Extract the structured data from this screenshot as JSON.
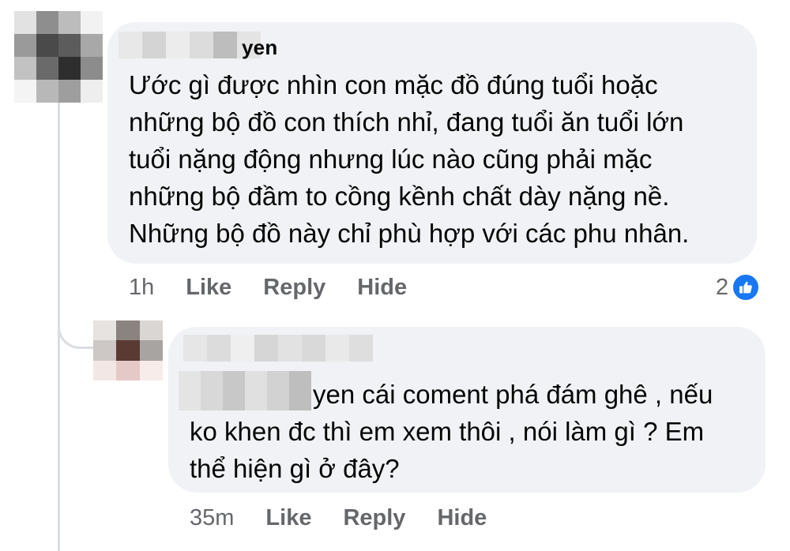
{
  "comments": {
    "main": {
      "author_suffix": "yen",
      "text": "Ước gì được nhìn con mặc đồ đúng tuổi hoặc\nnhững bộ đồ con thích nhỉ, đang tuổi ăn tuổi lớn\ntuổi nặng động nhưng lúc nào cũng phải mặc\nnhững bộ đầm to cồng kềnh chất dày nặng nề.\nNhững bộ đồ này chỉ phù hợp với các phu nhân.",
      "timestamp": "1h",
      "like_label": "Like",
      "reply_label": "Reply",
      "hide_label": "Hide",
      "reaction_count": "2",
      "reaction_icon": "like-thumbs-up-icon"
    },
    "reply": {
      "line1": "yen cái coment phá đám ghê , nếu",
      "line2": "ko khen đc thì em xem thôi , nói làm gì ? Em",
      "line3": "thể hiện gì ở đây?",
      "timestamp": "35m",
      "like_label": "Like",
      "reply_label": "Reply",
      "hide_label": "Hide"
    }
  },
  "colors": {
    "bubble_background": "#f0f2f5",
    "meta_text": "#65676b",
    "primary_text": "#050505",
    "like_blue": "#1877f2",
    "thread_line": "#dadde1"
  }
}
